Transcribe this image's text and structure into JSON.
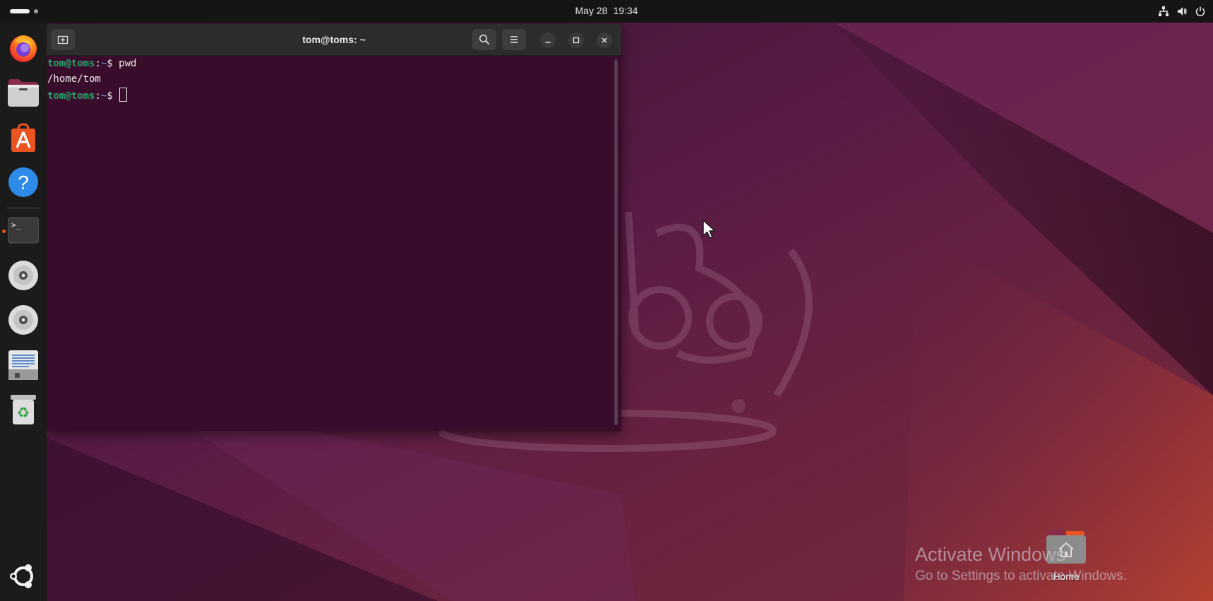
{
  "topbar": {
    "date": "May 28",
    "time": "19:34"
  },
  "dock": {
    "items": [
      {
        "name": "Firefox",
        "icon": "firefox-icon"
      },
      {
        "name": "Files",
        "icon": "files-icon"
      },
      {
        "name": "App Center",
        "icon": "app-center-icon"
      },
      {
        "name": "Help",
        "icon": "help-icon",
        "glyph": "?"
      },
      {
        "name": "Terminal",
        "icon": "terminal-icon",
        "glyph": ">_",
        "running": true
      },
      {
        "name": "Disc 1",
        "icon": "disc-icon"
      },
      {
        "name": "Disc 2",
        "icon": "disc-icon"
      },
      {
        "name": "Text Editor",
        "icon": "text-editor-icon"
      },
      {
        "name": "Trash",
        "icon": "trash-icon",
        "glyph": "♻"
      }
    ],
    "show_apps_icon": "ubuntu-logo-icon"
  },
  "terminal": {
    "title": "tom@toms: ~",
    "lines": [
      {
        "user": "tom@toms",
        "colon": ":",
        "path": "~",
        "dollar": "$ ",
        "command": "pwd"
      },
      {
        "output": "/home/tom"
      },
      {
        "user": "tom@toms",
        "colon": ":",
        "path": "~",
        "dollar": "$ ",
        "command": ""
      }
    ]
  },
  "desktop": {
    "home_label": "Home"
  },
  "watermark": {
    "line1": "Activate Windows",
    "line2": "Go to Settings to activate Windows."
  },
  "colors": {
    "terminal_bg": "#380c2a",
    "prompt_green": "#26a269",
    "accent_orange": "#e95420",
    "topbar_bg": "#151515",
    "dock_bg": "#1b1b1b"
  }
}
